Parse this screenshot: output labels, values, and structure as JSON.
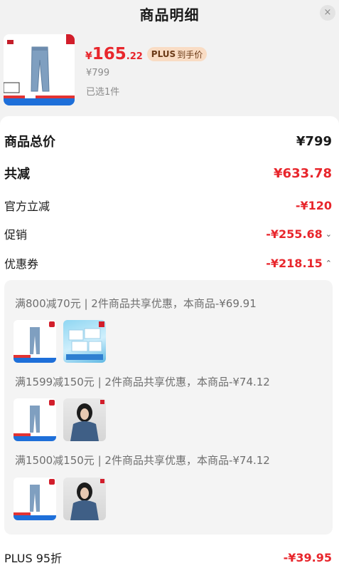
{
  "header": {
    "title": "商品明细",
    "close_icon": "×"
  },
  "product": {
    "price_symbol": "¥",
    "price_int": "165",
    "price_dec": ".22",
    "plus_badge_strong": "PLUS",
    "plus_badge_text": "到手价",
    "orig_price": "¥799",
    "selected_count": "已选1件"
  },
  "summary": {
    "total_label": "商品总价",
    "total_value": "¥799",
    "reduce_label": "共减",
    "reduce_value": "¥633.78",
    "official_label": "官方立减",
    "official_value": "-¥120",
    "promo_label": "促销",
    "promo_value": "-¥255.68",
    "coupon_label": "优惠券",
    "coupon_value": "-¥218.15"
  },
  "coupons": [
    {
      "text": "满800减70元 | 2件商品共享优惠，本商品-¥69.91"
    },
    {
      "text": "满1599减150元 | 2件商品共享优惠，本商品-¥74.12"
    },
    {
      "text": "满1500减150元 | 2件商品共享优惠，本商品-¥74.12"
    }
  ],
  "plus": {
    "label": "PLUS 95折",
    "value": "-¥39.95"
  },
  "colors": {
    "accent_red": "#e8262c",
    "plus_badge_bg": "#f9dcc4"
  }
}
